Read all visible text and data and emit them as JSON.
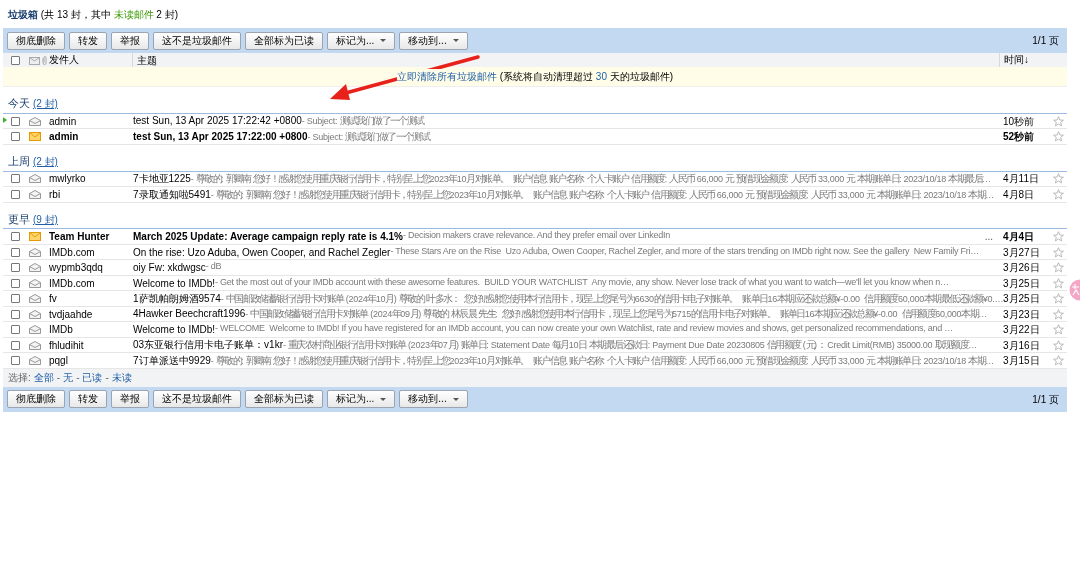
{
  "folder": {
    "title": "垃圾箱",
    "summary_before": "(共 13 封，其中 ",
    "unread_link": "未读邮件",
    "summary_after": " 2 封)"
  },
  "toolbar": {
    "buttons": [
      {
        "label": "彻底删除",
        "kind": "plain"
      },
      {
        "label": "转发",
        "kind": "plain"
      },
      {
        "label": "举报",
        "kind": "plain"
      },
      {
        "label": "这不是垃圾邮件",
        "kind": "plain"
      },
      {
        "label": "全部标为已读",
        "kind": "plain"
      },
      {
        "label": "标记为...",
        "kind": "dropdown"
      },
      {
        "label": "移动到...",
        "kind": "dropdown"
      }
    ],
    "pager": "1/1 页"
  },
  "columns": {
    "select_all_checked": false,
    "sender": "发件人",
    "subject": "主题",
    "time": "时间↓"
  },
  "notice": {
    "link": "立即清除所有垃圾邮件",
    "text_before": "(系统将自动清理超过 ",
    "days": "30",
    "text_after": " 天的垃圾邮件)"
  },
  "groups": [
    {
      "title": "今天",
      "count": "(2 封)",
      "messages": [
        {
          "sender": "admin",
          "subject": "test Sun, 13 Apr 2025 17:22:42 +0800",
          "preview": "- Subject: 测试我们做了一个测试",
          "time": "10秒前",
          "unread": false,
          "current": true,
          "checked": false
        },
        {
          "sender": "admin",
          "subject": "test Sun, 13 Apr 2025 17:22:00 +0800",
          "preview": "- Subject: 测试我们做了一个测试",
          "time": "52秒前",
          "unread": true,
          "current": false,
          "checked": false
        }
      ]
    },
    {
      "title": "上周",
      "count": "(2 封)",
      "messages": [
        {
          "sender": "mwlyrko",
          "subject": "7卡地亚1225",
          "preview": "- 尊敬的: 郭卿南 您好！感谢您使用重庆银行信用卡，特别呈上您2023年10月对账单。  账户信息 账户名称: 个人卡账户 信用额度: 人民币 66,000 元 预借现金额度: 人民币 33,000 元 本期账单日: 2023/10/18 本期最后…",
          "time": "4月11日",
          "unread": false,
          "current": false,
          "checked": false
        },
        {
          "sender": "rbi",
          "subject": "7录取通知啦5491",
          "preview": "- 尊敬的: 郭卿南 您好！感谢您使用重庆银行信用卡，特别呈上您2023年10月对账单。  账户信息 账户名称: 个人卡账户 信用额度: 人民币 66,000 元 预借现金额度: 人民币 33,000 元 本期账单日: 2023/10/18 本期…",
          "time": "4月8日",
          "unread": false,
          "current": false,
          "checked": false
        }
      ]
    },
    {
      "title": "更早",
      "count": "(9 封)",
      "messages": [
        {
          "sender": "Team Hunter",
          "subject": "March 2025 Update: Average campaign reply rate is 4.1%",
          "preview": "- Decision makers crave relevance. And they prefer email over LinkedIn",
          "more": "...",
          "time": "4月4日",
          "unread": true,
          "current": false,
          "checked": false
        },
        {
          "sender": "IMDb.com",
          "subject": "On the rise: Uzo Aduba, Owen Cooper, and Rachel Zegler",
          "preview": "- These Stars Are on the Rise  Uzo Aduba, Owen Cooper, Rachel Zegler, and more of the stars trending on IMDb right now. See the gallery  New Family Fri…",
          "time": "3月27日",
          "unread": false,
          "current": false,
          "checked": false
        },
        {
          "sender": "wypmb3qdq",
          "subject": "oiy Fw: xkdwgsc",
          "preview": "- dB",
          "time": "3月26日",
          "unread": false,
          "current": false,
          "checked": false
        },
        {
          "sender": "IMDb.com",
          "subject": "Welcome to IMDb!",
          "preview": "- Get the most out of your IMDb account with these awesome features.  BUILD YOUR WATCHLIST  Any movie, any show. Never lose track of what you want to watch—we'll let you know when n…",
          "time": "3月25日",
          "unread": false,
          "current": false,
          "checked": false
        },
        {
          "sender": "fv",
          "subject": "1萨凯帕朗姆酒9574",
          "preview": "- 中国邮政储蓄银行信用卡对账单 (2024年10月) 尊敬的 叶多水：  您好!感谢您使用本行信用卡，现呈上您尾号为6630的信用卡电子对账单。  账单日16本期应还款总额¥-0.00  信用额度60,000本期最低还款额¥0.…",
          "time": "3月25日",
          "unread": false,
          "current": false,
          "checked": false
        },
        {
          "sender": "tvdjaahde",
          "subject": "4Hawker Beechcraft1996",
          "preview": "- 中国邮政储蓄银行信用卡对账单 (2024年09月) 尊敬的 林辰晨 先生:  您好!感谢您使用本行信用卡，现呈上您尾号为5715的信用卡电子对账单。  账单日16本期应还款总额¥-0.00  信用额度60,000本期…",
          "time": "3月23日",
          "unread": false,
          "current": false,
          "checked": false
        },
        {
          "sender": "IMDb",
          "subject": "Welcome to IMDb!",
          "preview": "- WELCOME  Welcome to IMDb! If you have registered for an IMDb account, you can now create your own Watchlist, rate and review movies and shows, get personalized recommendations, and …",
          "time": "3月22日",
          "unread": false,
          "current": false,
          "checked": false
        },
        {
          "sender": "fhludihit",
          "subject": "03东亚银行信用卡电子账单：v1kr",
          "preview": "- 重庆农村商业银行信用卡对账单 (2023年07月) 账单日: Statement Date 每月10日 本期最后还款日: Payment Due Date 20230805 信用额度 (元)： Credit Limit(RMB) 35000.00 取现额度…",
          "time": "3月16日",
          "unread": false,
          "current": false,
          "checked": false
        },
        {
          "sender": "pqgl",
          "subject": "7订单派送中9929",
          "preview": "- 尊敬的: 郭卿南 您好！感谢您使用重庆银行信用卡，特别呈上您2023年10月对账单。  账户信息 账户名称: 个人卡账户 信用额度: 人民币 66,000 元 预借现金额度: 人民币 33,000 元 本期账单日: 2023/10/18 本期…",
          "time": "3月15日",
          "unread": false,
          "current": false,
          "checked": false
        }
      ]
    }
  ],
  "select_bar": {
    "label": "选择:",
    "items": [
      {
        "kind": "link",
        "text": "全部"
      },
      {
        "kind": "sep",
        "text": "-"
      },
      {
        "kind": "link",
        "text": "无"
      },
      {
        "kind": "sep",
        "text": "-"
      },
      {
        "kind": "link",
        "text": "已读"
      },
      {
        "kind": "sep",
        "text": "-"
      },
      {
        "kind": "link",
        "text": "未读"
      }
    ]
  },
  "bottom_toolbar": {
    "buttons": [
      {
        "label": "彻底删除",
        "kind": "plain"
      },
      {
        "label": "转发",
        "kind": "plain"
      },
      {
        "label": "举报",
        "kind": "plain"
      },
      {
        "label": "这不是垃圾邮件",
        "kind": "plain"
      },
      {
        "label": "全部标为已读",
        "kind": "plain"
      },
      {
        "label": "标记为...",
        "kind": "dropdown"
      },
      {
        "label": "移动到...",
        "kind": "dropdown"
      }
    ],
    "pager": "1/1 页"
  }
}
